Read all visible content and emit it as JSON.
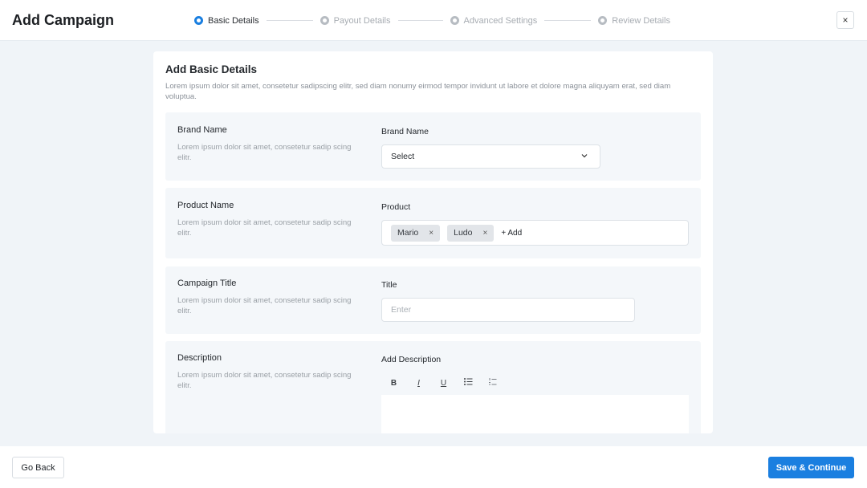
{
  "header": {
    "title": "Add Campaign",
    "close_icon": "×",
    "steps": [
      {
        "label": "Basic Details",
        "state": "active"
      },
      {
        "label": "Payout Details",
        "state": "inactive"
      },
      {
        "label": "Advanced Settings",
        "state": "inactive"
      },
      {
        "label": "Review Details",
        "state": "inactive"
      }
    ]
  },
  "card": {
    "title": "Add Basic Details",
    "description": "Lorem ipsum dolor sit amet, consetetur sadipscing elitr, sed diam nonumy eirmod tempor invidunt ut labore et dolore magna aliquyam erat, sed diam voluptua."
  },
  "sections": {
    "brand": {
      "title": "Brand Name",
      "description": "Lorem ipsum dolor sit amet, consetetur sadip scing elitr.",
      "field_label": "Brand Name",
      "select_value": "Select"
    },
    "product": {
      "title": "Product Name",
      "description": "Lorem ipsum dolor sit amet, consetetur sadip scing elitr.",
      "field_label": "Product",
      "tags": [
        "Mario",
        "Ludo"
      ],
      "tag_remove_icon": "×",
      "add_label": "+ Add"
    },
    "campaign_title": {
      "title": "Campaign Title",
      "description": "Lorem ipsum dolor sit amet, consetetur sadip scing elitr.",
      "field_label": "Title",
      "placeholder": "Enter",
      "value": ""
    },
    "description": {
      "title": "Description",
      "description": "Lorem ipsum dolor sit amet, consetetur sadip scing elitr.",
      "field_label": "Add Description",
      "toolbar": {
        "bold": "B",
        "italic": "I",
        "underline": "U"
      },
      "value": ""
    }
  },
  "footer": {
    "back_label": "Go Back",
    "save_label": "Save & Continue"
  },
  "colors": {
    "accent": "#1a7fe0",
    "background": "#f0f4f8",
    "section_bg": "#f4f7fa"
  }
}
